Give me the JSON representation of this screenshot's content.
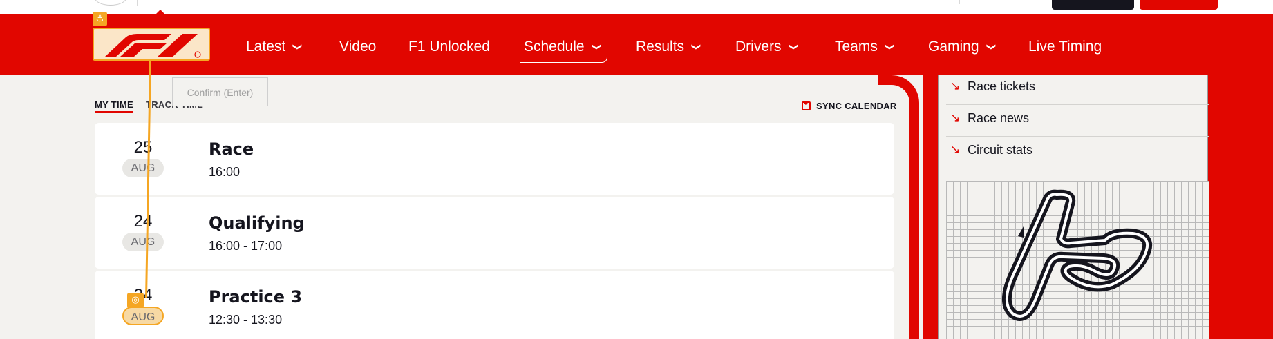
{
  "nav": {
    "items": [
      {
        "label": "Latest",
        "has_dropdown": true
      },
      {
        "label": "Video",
        "has_dropdown": false
      },
      {
        "label": "F1 Unlocked",
        "has_dropdown": false
      },
      {
        "label": "Schedule",
        "has_dropdown": true,
        "active": true
      },
      {
        "label": "Results",
        "has_dropdown": true
      },
      {
        "label": "Drivers",
        "has_dropdown": true
      },
      {
        "label": "Teams",
        "has_dropdown": true
      },
      {
        "label": "Gaming",
        "has_dropdown": true
      },
      {
        "label": "Live Timing",
        "has_dropdown": false
      }
    ],
    "chevron": "⌄"
  },
  "tooltip": {
    "text": "Confirm (Enter)"
  },
  "tabs": {
    "my_time": "MY TIME",
    "track_time": "TRACK TIME"
  },
  "sync": {
    "label": "SYNC CALENDAR"
  },
  "sessions": [
    {
      "day": "25",
      "month": "AUG",
      "name": "Race",
      "time": "16:00"
    },
    {
      "day": "24",
      "month": "AUG",
      "name": "Qualifying",
      "time": "16:00 - 17:00"
    },
    {
      "day": "24",
      "month": "AUG",
      "name": "Practice 3",
      "time": "12:30 - 13:30"
    }
  ],
  "sidebar": {
    "links": [
      {
        "label": "Race tickets"
      },
      {
        "label": "Race news"
      },
      {
        "label": "Circuit stats"
      }
    ],
    "arrow": "↘"
  },
  "colors": {
    "brand_red": "#e10600",
    "focus_orange": "#f5a623",
    "logo_bg": "#fbe6c8"
  }
}
